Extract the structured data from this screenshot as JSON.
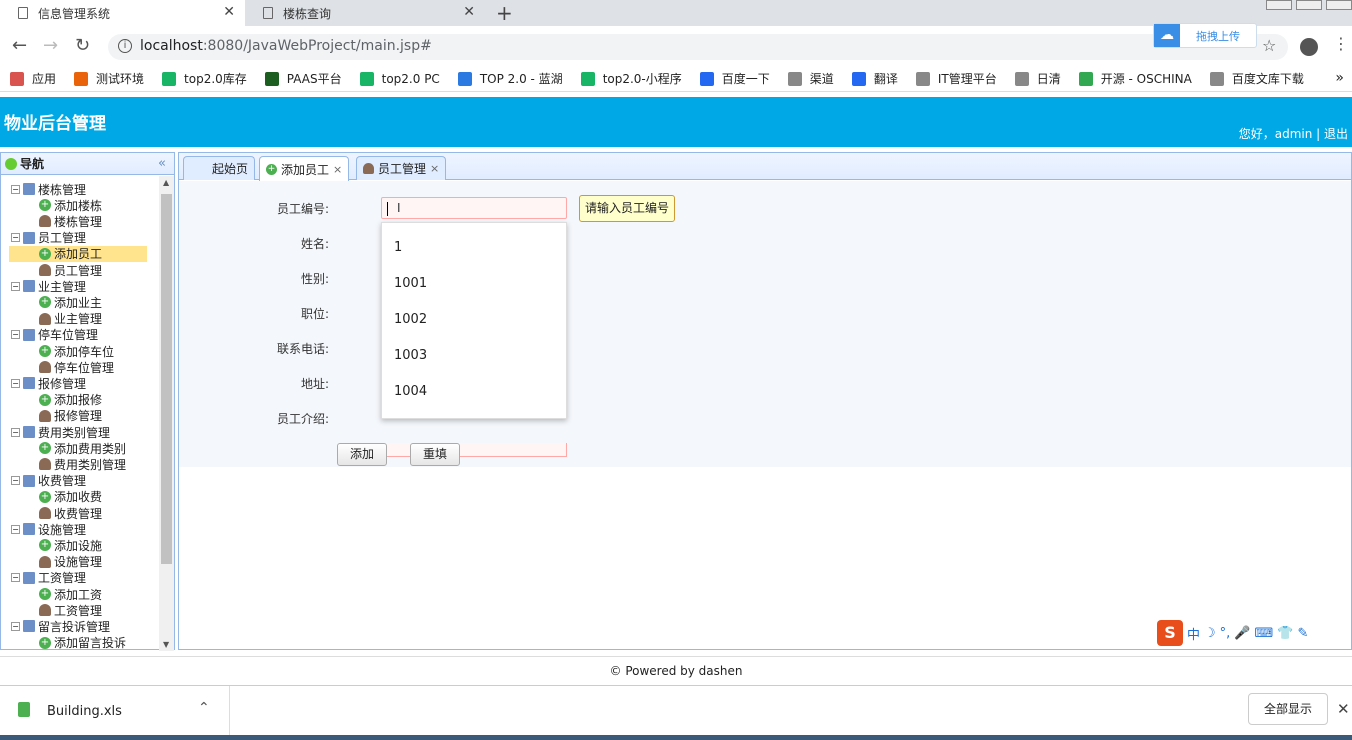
{
  "browser": {
    "tabs": [
      {
        "title": "信息管理系统",
        "active": true
      },
      {
        "title": "楼栋查询",
        "active": false
      }
    ],
    "url_host": "localhost",
    "url_rest": ":8080/JavaWebProject/main.jsp#",
    "upload_label": "拖拽上传",
    "bookmarks": [
      {
        "label": "应用",
        "color": "#d9534f"
      },
      {
        "label": "测试环境",
        "color": "#e8630a"
      },
      {
        "label": "top2.0库存",
        "color": "#18b566"
      },
      {
        "label": "PAAS平台",
        "color": "#1b5e20"
      },
      {
        "label": "top2.0 PC",
        "color": "#18b566"
      },
      {
        "label": "TOP 2.0 - 蓝湖",
        "color": "#2a7ae2"
      },
      {
        "label": "top2.0-小程序",
        "color": "#18b566"
      },
      {
        "label": "百度一下",
        "color": "#2468f2"
      },
      {
        "label": "渠道",
        "color": "#888888"
      },
      {
        "label": "翻译",
        "color": "#2468f2"
      },
      {
        "label": "IT管理平台",
        "color": "#888888"
      },
      {
        "label": "日清",
        "color": "#888888"
      },
      {
        "label": "开源 - OSCHINA",
        "color": "#33a852"
      },
      {
        "label": "百度文库下载",
        "color": "#888888"
      }
    ],
    "bookmarks_more": "»"
  },
  "app": {
    "title": "物业后台管理",
    "greeting": "您好，admin | 退出",
    "nav_title": "导航",
    "collapse_glyph": "«",
    "tree": [
      {
        "label": "楼栋管理",
        "type": "folder"
      },
      {
        "label": "添加楼栋",
        "type": "add"
      },
      {
        "label": "楼栋管理",
        "type": "user"
      },
      {
        "label": "员工管理",
        "type": "folder"
      },
      {
        "label": "添加员工",
        "type": "add",
        "selected": true
      },
      {
        "label": "员工管理",
        "type": "user"
      },
      {
        "label": "业主管理",
        "type": "folder"
      },
      {
        "label": "添加业主",
        "type": "add"
      },
      {
        "label": "业主管理",
        "type": "user"
      },
      {
        "label": "停车位管理",
        "type": "folder"
      },
      {
        "label": "添加停车位",
        "type": "add"
      },
      {
        "label": "停车位管理",
        "type": "user"
      },
      {
        "label": "报修管理",
        "type": "folder"
      },
      {
        "label": "添加报修",
        "type": "add"
      },
      {
        "label": "报修管理",
        "type": "user"
      },
      {
        "label": "费用类别管理",
        "type": "folder"
      },
      {
        "label": "添加费用类别",
        "type": "add"
      },
      {
        "label": "费用类别管理",
        "type": "user"
      },
      {
        "label": "收费管理",
        "type": "folder"
      },
      {
        "label": "添加收费",
        "type": "add"
      },
      {
        "label": "收费管理",
        "type": "user"
      },
      {
        "label": "设施管理",
        "type": "folder"
      },
      {
        "label": "添加设施",
        "type": "add"
      },
      {
        "label": "设施管理",
        "type": "user"
      },
      {
        "label": "工资管理",
        "type": "folder"
      },
      {
        "label": "添加工资",
        "type": "add"
      },
      {
        "label": "工资管理",
        "type": "user"
      },
      {
        "label": "留言投诉管理",
        "type": "folder"
      },
      {
        "label": "添加留言投诉",
        "type": "add"
      }
    ],
    "tabs": [
      {
        "label": "起始页",
        "icon": "none",
        "closable": false
      },
      {
        "label": "添加员工",
        "icon": "add",
        "closable": true,
        "active": true
      },
      {
        "label": "员工管理",
        "icon": "user",
        "closable": true
      }
    ],
    "form": {
      "labels": [
        "员工编号:",
        "姓名:",
        "性别:",
        "职位:",
        "联系电话:",
        "地址:",
        "员工介绍:"
      ],
      "tip": "请输入员工编号",
      "suggestions": [
        "1",
        "1001",
        "1002",
        "1003",
        "1004"
      ],
      "add_button": "添加",
      "reset_button": "重填"
    },
    "ime_chars": [
      "中",
      "☽",
      "°,",
      "🎤",
      "⌨",
      "👕",
      "✎"
    ],
    "footer": "© Powered by dashen"
  },
  "downloads": {
    "file": "Building.xls",
    "show_all": "全部显示"
  }
}
